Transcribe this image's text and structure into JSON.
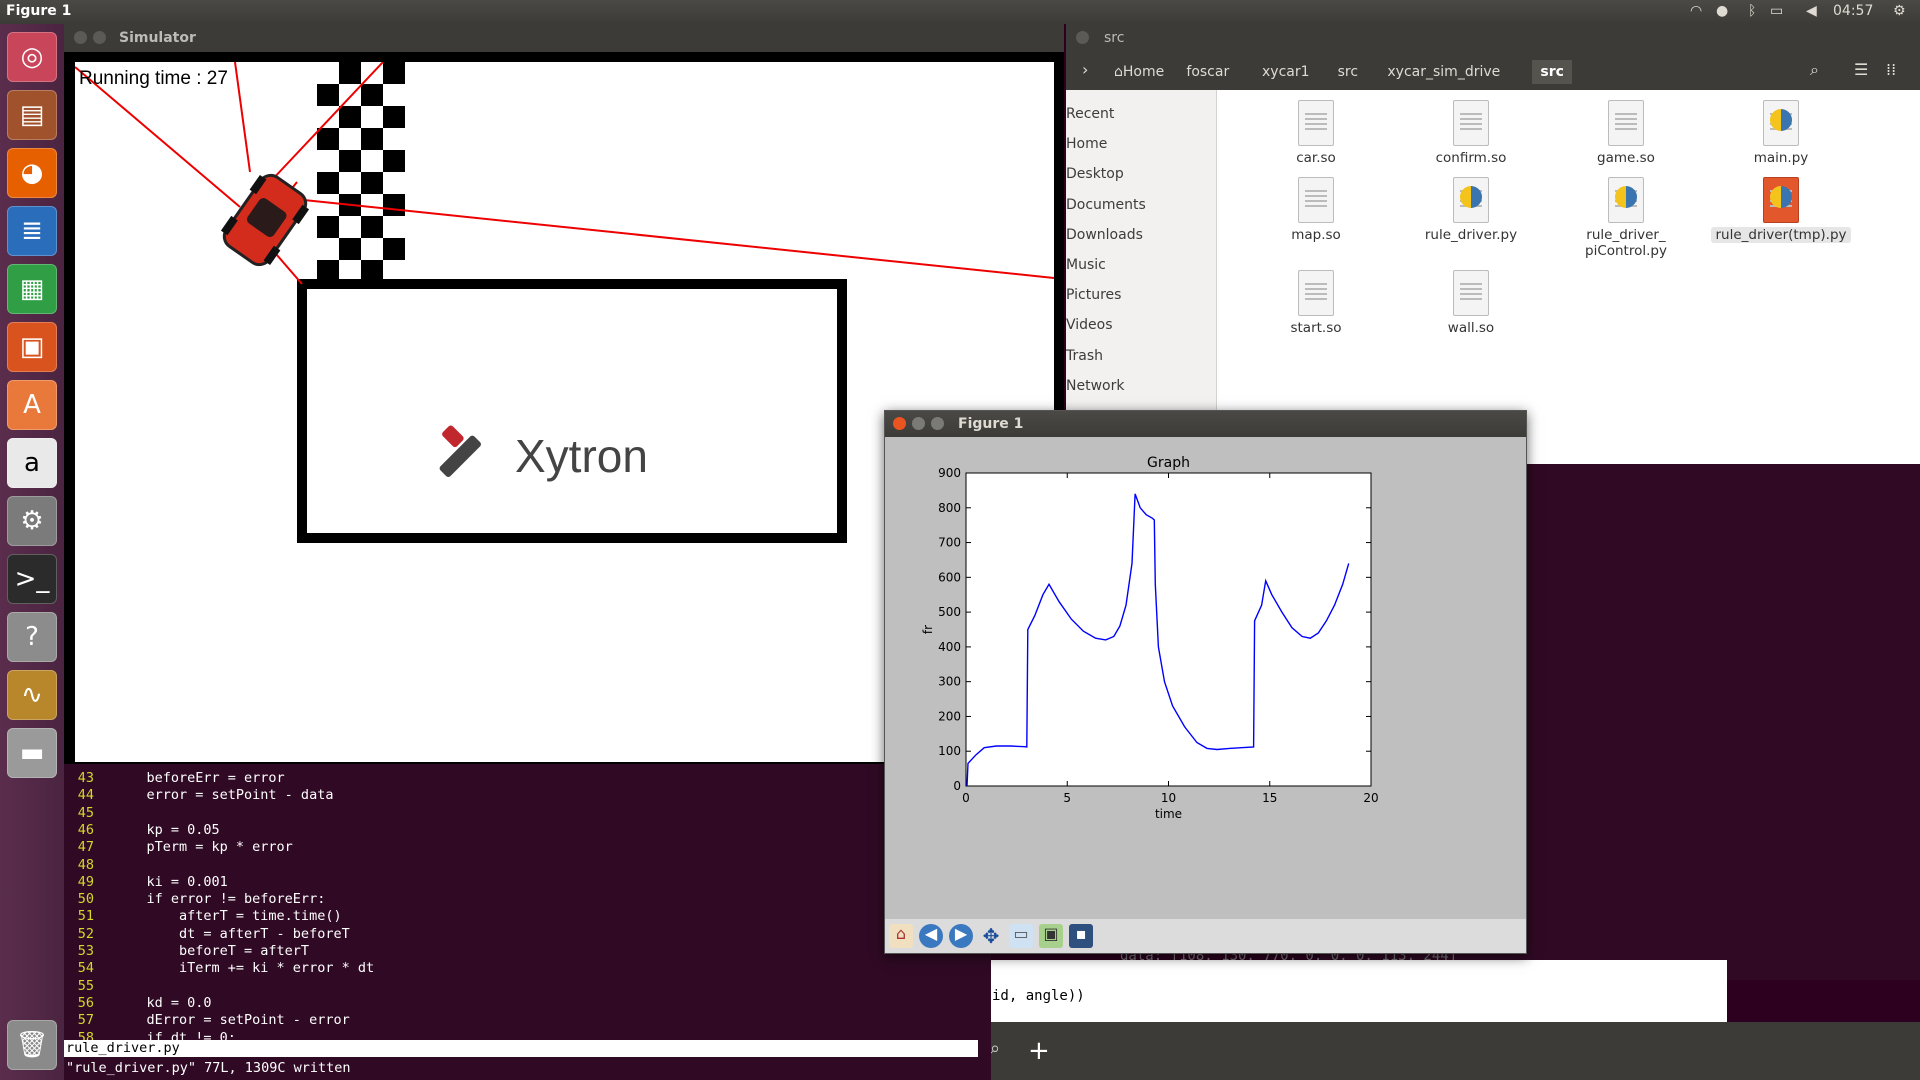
{
  "top_panel": {
    "title": "Figure 1",
    "clock": "04:57"
  },
  "launcher": {
    "items": [
      "ubuntu",
      "files",
      "firefox",
      "writer",
      "calc",
      "impress",
      "software",
      "amazon",
      "settings",
      "terminal",
      "help",
      "oscilloscope",
      "drive",
      "trash"
    ]
  },
  "simulator": {
    "window_title": "Simulator",
    "running_time": "Running time : 27",
    "logo_text": "Xytron"
  },
  "file_manager": {
    "window_title": "src",
    "breadcrumbs": [
      "Home",
      "foscar",
      "xycar1",
      "src",
      "xycar_sim_drive",
      "src"
    ],
    "sidebar": [
      "Recent",
      "Home",
      "Desktop",
      "Documents",
      "Downloads",
      "Music",
      "Pictures",
      "Videos",
      "Trash",
      "Network"
    ],
    "files": [
      {
        "name": "car.so",
        "type": "so"
      },
      {
        "name": "confirm.so",
        "type": "so"
      },
      {
        "name": "game.so",
        "type": "so"
      },
      {
        "name": "main.py",
        "type": "py"
      },
      {
        "name": "map.so",
        "type": "so"
      },
      {
        "name": "rule_driver.py",
        "type": "py"
      },
      {
        "name": "rule_driver_\npiControl.py",
        "type": "py"
      },
      {
        "name": "rule_driver(tmp).py",
        "type": "py-selected"
      },
      {
        "name": "start.so",
        "type": "so"
      },
      {
        "name": "wall.so",
        "type": "so"
      }
    ]
  },
  "terminal": {
    "lines": [
      {
        "n": "43",
        "code": "    beforeErr = error"
      },
      {
        "n": "44",
        "code": "    error = setPoint - data"
      },
      {
        "n": "45",
        "code": ""
      },
      {
        "n": "46",
        "code": "    kp = 0.05"
      },
      {
        "n": "47",
        "code": "    pTerm = kp * error"
      },
      {
        "n": "48",
        "code": ""
      },
      {
        "n": "49",
        "code": "    ki = 0.001"
      },
      {
        "n": "50",
        "code": "    if error != beforeErr:"
      },
      {
        "n": "51",
        "code": "        afterT = time.time()"
      },
      {
        "n": "52",
        "code": "        dt = afterT - beforeT"
      },
      {
        "n": "53",
        "code": "        beforeT = afterT"
      },
      {
        "n": "54",
        "code": "        iTerm += ki * error * dt"
      },
      {
        "n": "55",
        "code": ""
      },
      {
        "n": "56",
        "code": "    kd = 0.0"
      },
      {
        "n": "57",
        "code": "    dError = setPoint - error"
      },
      {
        "n": "58",
        "code": "    if dt != 0:"
      }
    ],
    "status_bar": "rule_driver.py",
    "message": "\"rule_driver.py\" 77L, 1309C written"
  },
  "terminal2": {
    "data_line": "data: [108, 130, 770, 0, 0, 0, 113, 244]",
    "code_line": "id, angle))"
  },
  "figure": {
    "window_title": "Figure 1"
  },
  "chart_data": {
    "type": "line",
    "title": "Graph",
    "xlabel": "time",
    "ylabel": "fr",
    "xlim": [
      0,
      20
    ],
    "ylim": [
      0,
      900
    ],
    "xticks": [
      "0",
      "5",
      "10",
      "15",
      "20"
    ],
    "yticks": [
      "0",
      "100",
      "200",
      "300",
      "400",
      "500",
      "600",
      "700",
      "800",
      "900"
    ],
    "series": [
      {
        "color": "#0000ff",
        "x": [
          0.05,
          0.1,
          0.5,
          0.9,
          1.5,
          2.2,
          2.9,
          3.0,
          3.05,
          3.4,
          3.8,
          4.1,
          4.6,
          5.2,
          5.8,
          6.4,
          6.9,
          7.3,
          7.6,
          7.9,
          8.2,
          8.35,
          8.6,
          8.9,
          9.2,
          9.3,
          9.35,
          9.5,
          9.8,
          10.2,
          10.8,
          11.4,
          11.9,
          12.4,
          13.0,
          13.6,
          14.2,
          14.25,
          14.6,
          14.8,
          15.1,
          15.6,
          16.1,
          16.6,
          17.0,
          17.4,
          17.8,
          18.2,
          18.6,
          18.9
        ],
        "y": [
          0,
          65,
          90,
          110,
          115,
          115,
          113,
          112,
          450,
          490,
          550,
          580,
          530,
          480,
          445,
          425,
          420,
          430,
          460,
          520,
          640,
          840,
          800,
          780,
          770,
          765,
          580,
          400,
          300,
          230,
          170,
          125,
          108,
          105,
          108,
          110,
          112,
          475,
          520,
          590,
          550,
          500,
          455,
          430,
          425,
          440,
          475,
          520,
          580,
          640
        ]
      }
    ]
  }
}
